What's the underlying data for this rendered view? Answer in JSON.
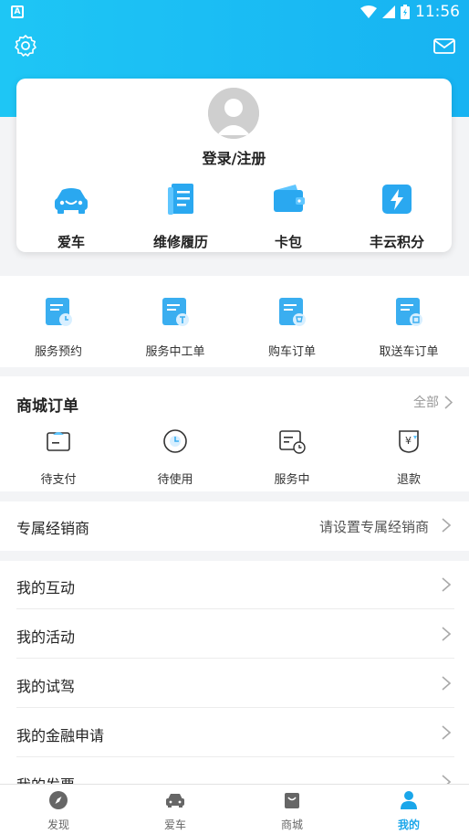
{
  "status_bar": {
    "time": "11:56"
  },
  "profile": {
    "login_label": "登录/注册"
  },
  "card_items": [
    {
      "label": "爱车",
      "icon": "car-icon"
    },
    {
      "label": "维修履历",
      "icon": "maintenance-record-icon"
    },
    {
      "label": "卡包",
      "icon": "wallet-icon"
    },
    {
      "label": "丰云积分",
      "icon": "points-bolt-icon"
    }
  ],
  "services": [
    {
      "label": "服务预约",
      "icon": "service-appointment-icon"
    },
    {
      "label": "服务中工单",
      "icon": "work-order-icon"
    },
    {
      "label": "购车订单",
      "icon": "purchase-order-icon"
    },
    {
      "label": "取送车订单",
      "icon": "pickup-order-icon"
    }
  ],
  "mall": {
    "title": "商城订单",
    "all_label": "全部",
    "orders": [
      {
        "label": "待支付",
        "icon": "pending-payment-icon"
      },
      {
        "label": "待使用",
        "icon": "pending-use-icon"
      },
      {
        "label": "服务中",
        "icon": "in-service-icon"
      },
      {
        "label": "退款",
        "icon": "refund-icon"
      }
    ]
  },
  "dealer": {
    "title": "专属经销商",
    "placeholder": "请设置专属经销商"
  },
  "menu": [
    {
      "label": "我的互动"
    },
    {
      "label": "我的活动"
    },
    {
      "label": "我的试驾"
    },
    {
      "label": "我的金融申请"
    },
    {
      "label": "我的发票"
    }
  ],
  "tabs": [
    {
      "label": "发现",
      "icon": "compass-icon"
    },
    {
      "label": "爱车",
      "icon": "car-icon"
    },
    {
      "label": "商城",
      "icon": "shopping-bag-icon"
    },
    {
      "label": "我的",
      "icon": "person-icon"
    }
  ],
  "colors": {
    "accent": "#1aa6ea",
    "header": "#1ec6f5"
  }
}
